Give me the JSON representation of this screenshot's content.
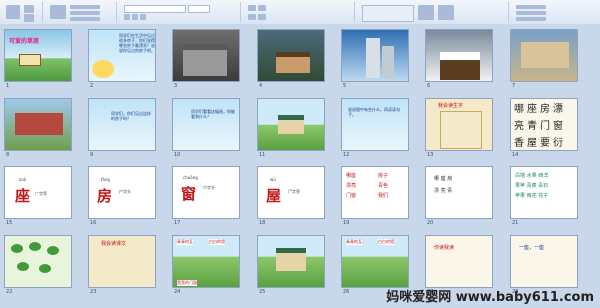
{
  "app": {
    "ribbon_groups": [
      "Clipboard",
      "Slides",
      "Font",
      "Paragraph",
      "Drawing",
      "Editing"
    ]
  },
  "slides": {
    "s1": {
      "title": "可爱的草原"
    },
    "s2": {
      "text": "同学们在生活中见过很多房子，你们觉得哪些房子最漂亮？说说你见过的房子吧。"
    },
    "s8": {
      "text": "同学们，你们见过这样的房子吗？"
    },
    "s9": {
      "text": "同学们看看这幅画，你能看到什么？"
    },
    "s11": {
      "text": "说说图中有些什么，再读读句子。"
    },
    "s12": {
      "title": "我会读生字"
    },
    "s13": {
      "lines": [
        "哪座房漂",
        "亮青门窗",
        "香屋要衍"
      ]
    },
    "s14": {
      "pinyin": "zuò",
      "char": "座",
      "hint": "广字旁"
    },
    "s15": {
      "pinyin": "fáng",
      "char": "房",
      "hint": "户字头"
    },
    "s16": {
      "pinyin": "chuāng",
      "char": "窗",
      "hint": "穴字头"
    },
    "s17": {
      "pinyin": "wū",
      "char": "屋",
      "hint": "尸字旁"
    },
    "s18": {
      "words": [
        "哪座",
        "房子",
        "漂亮",
        "青色",
        "门窗",
        "我们"
      ]
    },
    "s19": {
      "words": [
        "哪",
        "座",
        "房",
        "漂",
        "亮",
        "青"
      ]
    },
    "s20": {
      "words": [
        "白墙",
        "水果",
        "西洋",
        "果苹",
        "青菜",
        "青石",
        "苹果",
        "雨花",
        "花子"
      ]
    },
    "s21": {},
    "s22": {
      "title": "我会读课文"
    },
    "s23": {
      "labels": [
        "青青的瓦",
        "白白的墙",
        "宽宽的门窗"
      ]
    },
    "s24": {},
    "s25": {
      "labels": [
        "青青的瓦",
        "白白的墙"
      ]
    },
    "s26": {
      "lines": [
        "你读我读"
      ]
    },
    "s27": {
      "lines": [
        "一座，一座"
      ]
    }
  },
  "watermark": {
    "text": "妈咪爱婴网 www.baby611.com"
  }
}
